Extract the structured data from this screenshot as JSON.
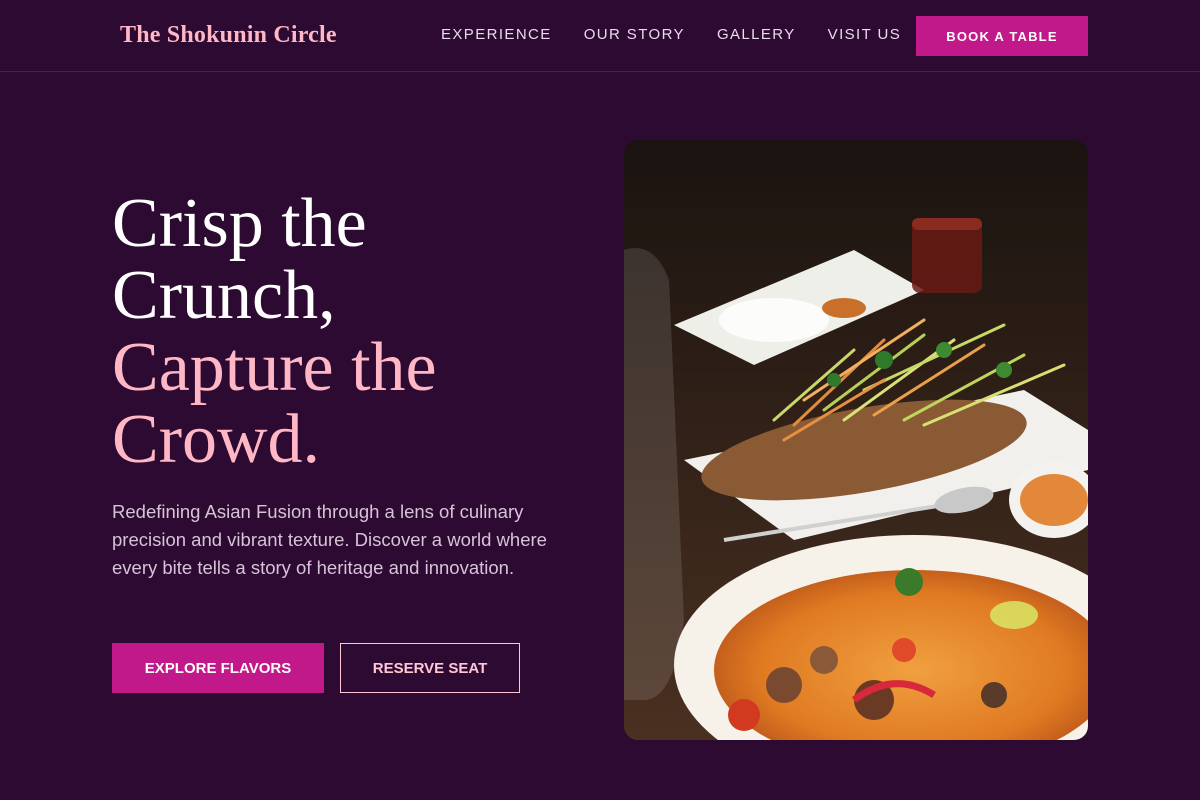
{
  "brand": {
    "name": "The Shokunin Circle"
  },
  "nav": {
    "links": [
      "EXPERIENCE",
      "OUR STORY",
      "GALLERY",
      "VISIT US"
    ],
    "cta": "BOOK A TABLE"
  },
  "hero": {
    "headline_line1": "Crisp the Crunch,",
    "headline_line2": "Capture the Crowd.",
    "description": "Redefining Asian Fusion through a lens of culinary precision and vibrant texture. Discover a world where every bite tells a story of heritage and innovation.",
    "primary_button": "EXPLORE FLAVORS",
    "secondary_button": "RESERVE SEAT"
  },
  "colors": {
    "background": "#2d0a31",
    "accent": "#c2198a",
    "pink": "#ffb7c5"
  }
}
